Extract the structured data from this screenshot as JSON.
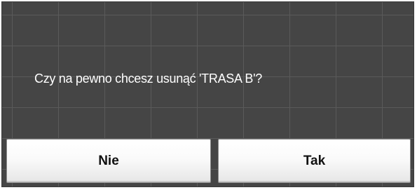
{
  "dialog": {
    "message": "Czy na pewno chcesz usunąć 'TRASA B'?",
    "no_label": "Nie",
    "yes_label": "Tak"
  }
}
